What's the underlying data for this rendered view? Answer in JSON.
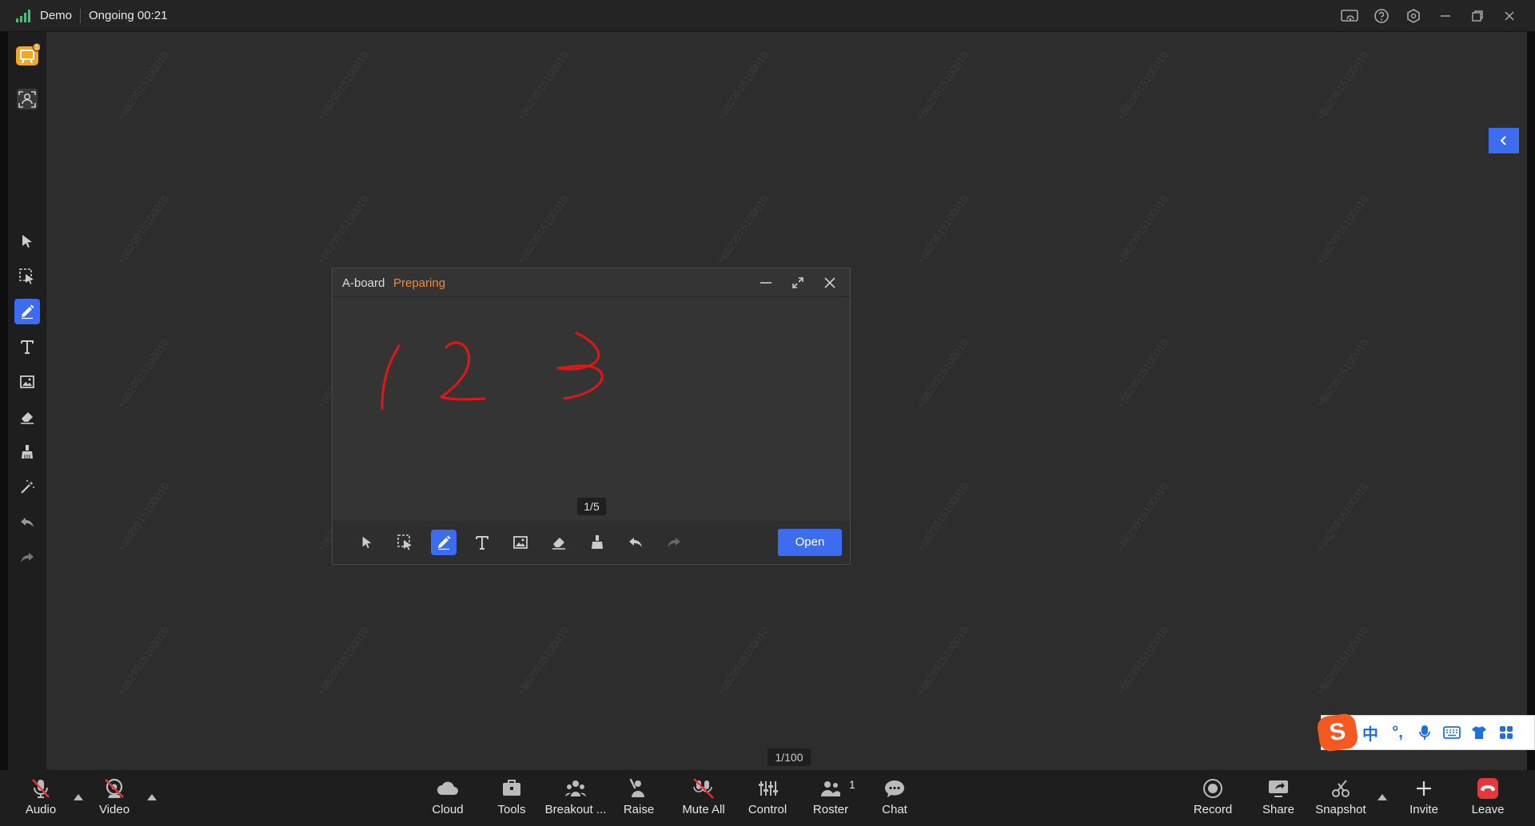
{
  "titlebar": {
    "app_name": "Demo",
    "status": "Ongoing 00:21"
  },
  "colors": {
    "accent": "#3c6cf0",
    "status_orange": "#f08a2c",
    "ink_red": "#e01717",
    "leave_red": "#e5383b"
  },
  "watermark": "+8629915100010",
  "aboard": {
    "title": "A-board",
    "status": "Preparing",
    "page": "1/5",
    "open_label": "Open",
    "drawing": "123"
  },
  "page_count": "1/100",
  "ime": {
    "items": [
      "中",
      "°,",
      "mic",
      "keyboard",
      "shirt",
      "grid"
    ]
  },
  "sidebar": {
    "tools": [
      "whiteboard",
      "participants",
      "select",
      "marquee-select",
      "pen",
      "text",
      "image",
      "eraser",
      "clear",
      "laser",
      "undo",
      "redo"
    ]
  },
  "bottombar": {
    "audio": "Audio",
    "video": "Video",
    "cloud": "Cloud",
    "tools": "Tools",
    "breakout": "Breakout ...",
    "raise": "Raise",
    "mute_all": "Mute All",
    "control": "Control",
    "roster": "Roster",
    "roster_count": "1",
    "chat": "Chat",
    "record": "Record",
    "share": "Share",
    "snapshot": "Snapshot",
    "invite": "Invite",
    "leave": "Leave"
  }
}
